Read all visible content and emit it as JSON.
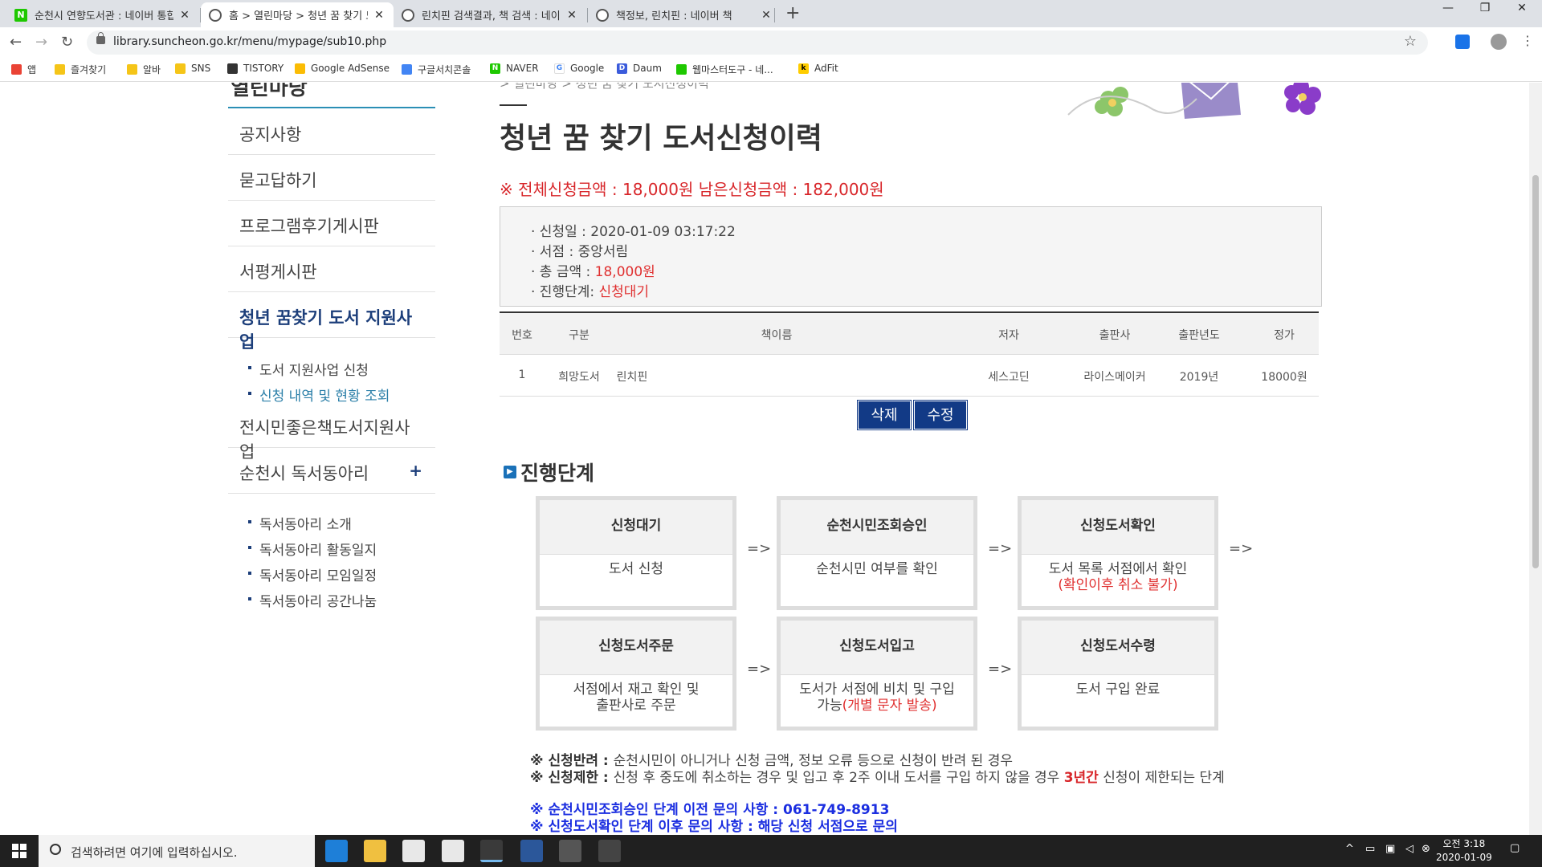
{
  "browser": {
    "tabs": [
      {
        "title": "순천시 연향도서관 : 네이버 통합검색"
      },
      {
        "title": "홈 > 열린마당 > 청년 꿈 찾기 도서지원사업"
      },
      {
        "title": "린치핀 검색결과, 책 검색 : 네이버"
      },
      {
        "title": "책정보, 린치핀 : 네이버 책"
      }
    ],
    "new_tab": "+",
    "close_glyph": "✕",
    "url": "library.suncheon.go.kr/menu/mypage/sub10.php",
    "bookmarks": [
      "앱",
      "즐겨찾기",
      "알바",
      "SNS",
      "TISTORY",
      "Google AdSense",
      "구글서치콘솔",
      "NAVER",
      "Google",
      "Daum",
      "웹마스터도구 - 네...",
      "AdFit"
    ]
  },
  "sidebar": {
    "title": "열린마당",
    "items": [
      {
        "label": "공지사항"
      },
      {
        "label": "묻고답하기"
      },
      {
        "label": "프로그램후기게시판"
      },
      {
        "label": "서평게시판"
      },
      {
        "label": "청년 꿈찾기 도서 지원사업"
      }
    ],
    "sub1": [
      "도서 지원사업 신청",
      "신청 내역 및 현황 조회"
    ],
    "item6": "전시민좋은책도서지원사업",
    "item7": "순천시 독서동아리",
    "sub2": [
      "독서동아리 소개",
      "독서동아리 활동일지",
      "독서동아리 모임일정",
      "독서동아리 공간나눔"
    ]
  },
  "main": {
    "breadcrumb": "> 열린마당 > 청년 꿈 찾기 도서신청이력",
    "title": "청년 꿈 찾기 도서신청이력",
    "amount": "※ 전체신청금액 : 18,000원   남은신청금액 : 182,000원",
    "info": {
      "date_label": "· 신청일 : ",
      "date": "2020-01-09 03:17:22",
      "store_label": "· 서점 : ",
      "store": "중앙서림",
      "total_label": "· 총 금액 : ",
      "total": "18,000원",
      "stage_label": "· 진행단계: ",
      "stage": "신청대기"
    },
    "table": {
      "headers": [
        "번호",
        "구분",
        "책이름",
        "저자",
        "출판사",
        "출판년도",
        "정가"
      ],
      "rows": [
        [
          "1",
          "희망도서",
          "린치핀",
          "세스고딘",
          "라이스메이커",
          "2019년",
          "18000원"
        ]
      ]
    },
    "delete_btn": "삭제",
    "edit_btn": "수정",
    "section_title": "진행단계",
    "arrow": "=>",
    "steps": [
      {
        "head": "신청대기",
        "desc": "도서 신청"
      },
      {
        "head": "순천시민조회승인",
        "desc": "순천시민 여부를 확인"
      },
      {
        "head": "신청도서확인",
        "desc": "도서 목록 서점에서 확인",
        "desc_red": "(확인이후 취소 불가)"
      },
      {
        "head": "신청도서주문",
        "desc": "서점에서 재고 확인 및",
        "desc2": "출판사로 주문"
      },
      {
        "head": "신청도서입고",
        "desc": "도서가 서점에 비치 및 구입",
        "desc2": "가능",
        "desc_red": "(개별 문자 발송)"
      },
      {
        "head": "신청도서수령",
        "desc": "도서 구입 완료"
      }
    ],
    "notes": {
      "n1_label": "※ 신청반려 : ",
      "n1": "순천시민이 아니거나 신청 금액, 정보 오류 등으로 신청이 반려 된 경우",
      "n2_label": "※ 신청제한 : ",
      "n2a": "신청 후 중도에 취소하는 경우 및 입고 후 2주 이내 도서를 구입 하지 않을 경우 ",
      "n2_red": "3년간",
      "n2b": " 신청이 제한되는 단계",
      "n3": "※ 순천시민조회승인 단계 이전 문의 사항 : 061-749-8913",
      "n4": "※ 신청도서확인 단계 이후 문의 사항 : 해당 신청 서점으로 문의"
    }
  },
  "taskbar": {
    "search_placeholder": "검색하려면 여기에 입력하십시오.",
    "time": "오전 3:18",
    "date": "2020-01-09"
  },
  "colors": {
    "accent_red": "#d8262a",
    "button_blue": "#123a86",
    "note_blue": "#1b2ee0"
  }
}
